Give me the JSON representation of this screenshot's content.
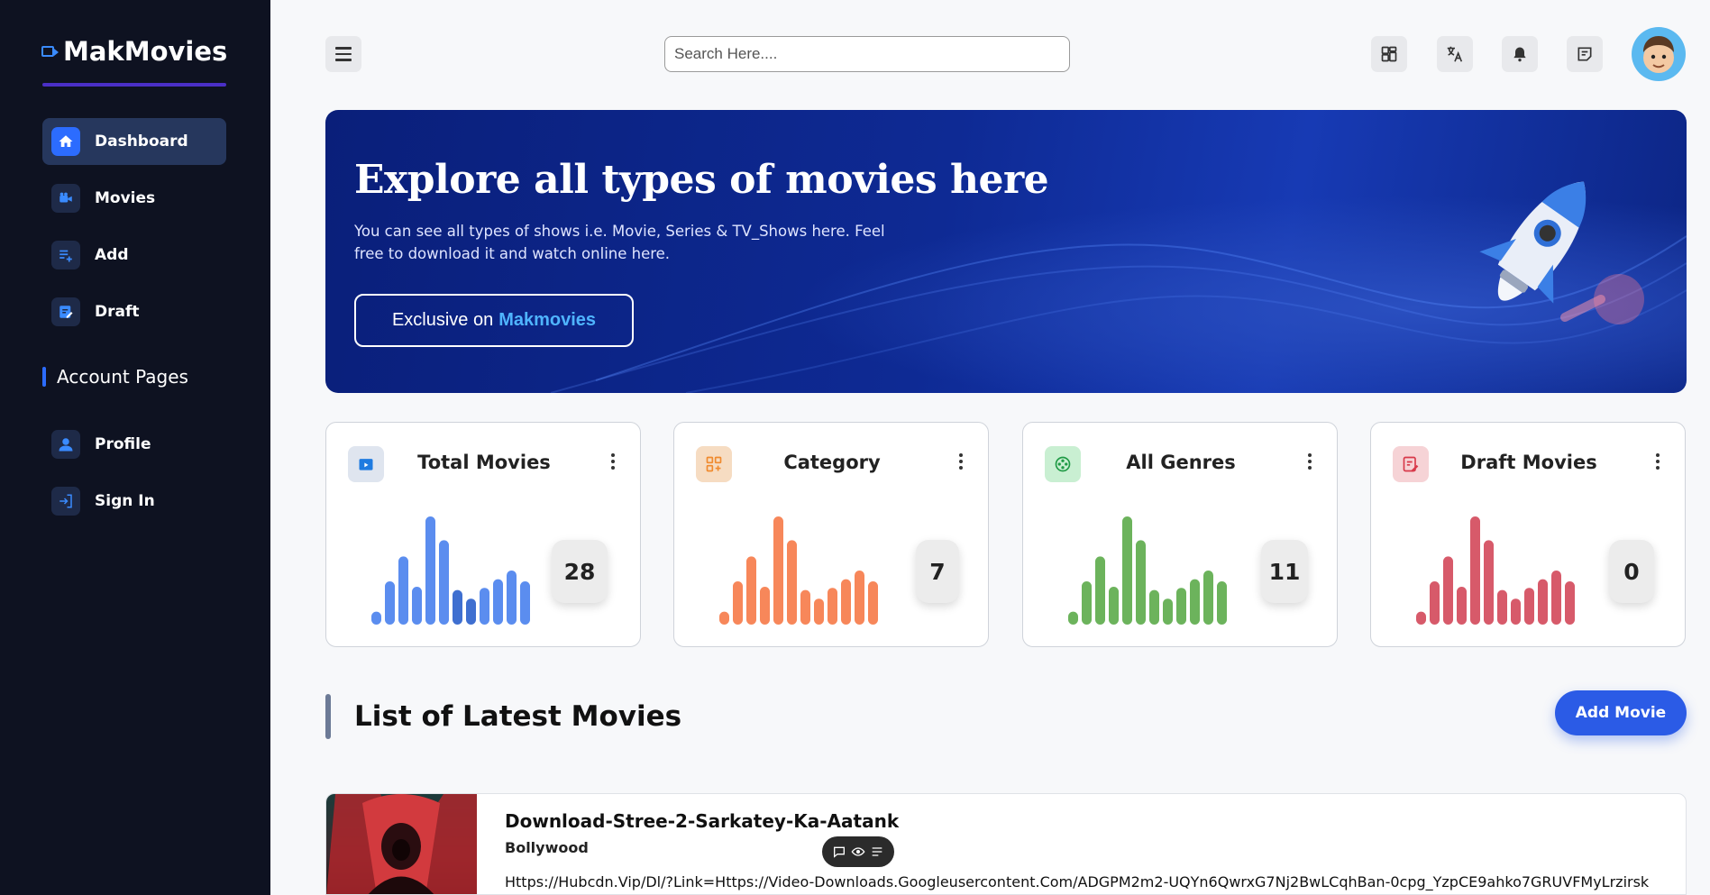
{
  "sidebar": {
    "brand": "MakMovies",
    "items": [
      {
        "label": "Dashboard"
      },
      {
        "label": "Movies"
      },
      {
        "label": "Add"
      },
      {
        "label": "Draft"
      }
    ],
    "section_title": "Account Pages",
    "account_items": [
      {
        "label": "Profile"
      },
      {
        "label": "Sign In"
      }
    ]
  },
  "topbar": {
    "search_placeholder": "Search Here...."
  },
  "banner": {
    "title": "Explore all types of movies here",
    "text": "You can see all types of shows i.e. Movie, Series & TV_Shows here. Feel free to download it and watch online here.",
    "button_prefix": "Exclusive on",
    "button_brand": "Makmovies"
  },
  "stats": [
    {
      "title": "Total Movies",
      "count": "28",
      "color": "#5b8def",
      "icon_bg": "#dfe5ef"
    },
    {
      "title": "Category",
      "count": "7",
      "color": "#f7875a",
      "icon_bg": "#f6dcc2"
    },
    {
      "title": "All Genres",
      "count": "11",
      "color": "#6cb35c",
      "icon_bg": "#c9efd2"
    },
    {
      "title": "Draft Movies",
      "count": "0",
      "color": "#d75a6a",
      "icon_bg": "#f6d3d6"
    }
  ],
  "list": {
    "heading": "List of Latest Movies",
    "add_button": "Add Movie",
    "movies": [
      {
        "title": "Download-Stree-2-Sarkatey-Ka-Aatank",
        "category": "Bollywood",
        "link": "Https://Hubcdn.Vip/Dl/?Link=Https://Video-Downloads.Googleusercontent.Com/ADGPM2m2-UQYn6QwrxG7Nj2BwLCqhBan-0cpg_YzpCE9ahko7GRUVFMyLrzirsk"
      }
    ]
  }
}
